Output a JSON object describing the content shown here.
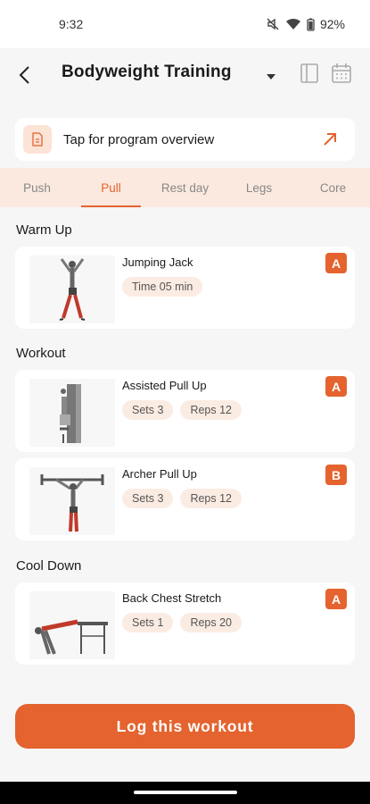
{
  "status_bar": {
    "time": "9:32",
    "battery": "92%",
    "icons": [
      "mute-icon",
      "wifi-icon",
      "battery-icon"
    ]
  },
  "header": {
    "title": "Bodyweight Training",
    "icons": [
      "back-arrow-icon",
      "chevron-down-icon",
      "page-icon",
      "calendar-icon"
    ]
  },
  "overview": {
    "label": "Tap for program overview",
    "icon": "document-icon",
    "action_icon": "arrow-up-right-icon"
  },
  "tabs": [
    {
      "label": "Push",
      "active": false
    },
    {
      "label": "Pull",
      "active": true
    },
    {
      "label": "Rest day",
      "active": false
    },
    {
      "label": "Legs",
      "active": false
    },
    {
      "label": "Core",
      "active": false
    }
  ],
  "sections": {
    "warm_up": {
      "title": "Warm Up",
      "exercises": [
        {
          "name": "Jumping Jack",
          "chips": [
            "Time 05 min"
          ],
          "level": "A"
        }
      ]
    },
    "workout": {
      "title": "Workout",
      "exercises": [
        {
          "name": "Assisted Pull Up",
          "chips": [
            "Sets 3",
            "Reps 12"
          ],
          "level": "A"
        },
        {
          "name": "Archer Pull Up",
          "chips": [
            "Sets 3",
            "Reps 12"
          ],
          "level": "B"
        }
      ]
    },
    "cool_down": {
      "title": "Cool Down",
      "exercises": [
        {
          "name": "Back Chest Stretch",
          "chips": [
            "Sets 1",
            "Reps 20"
          ],
          "level": "A"
        }
      ]
    }
  },
  "log_button": "Log this workout",
  "colors": {
    "accent": "#e4632f",
    "tab_bg": "#fbe9df",
    "chip_bg": "#fbece3",
    "page_bg": "#f6f6f6"
  }
}
